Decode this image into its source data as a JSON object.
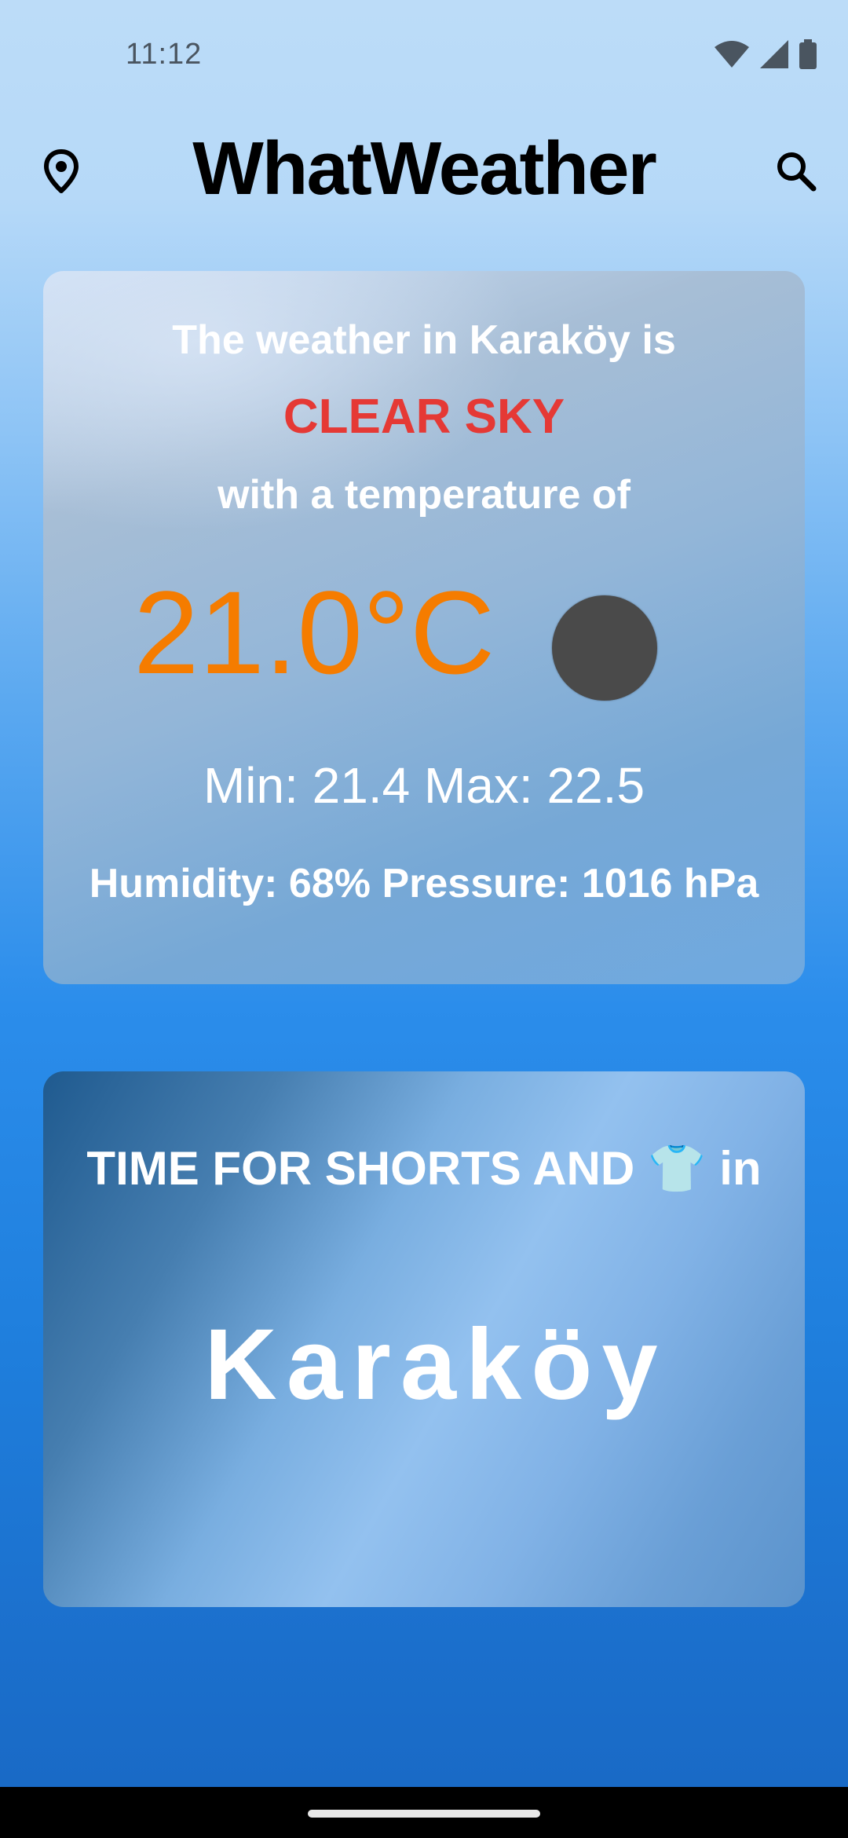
{
  "status_bar": {
    "time": "11:12"
  },
  "app_bar": {
    "title": "WhatWeather",
    "left_icon": "location-pin-icon",
    "right_icon": "search-icon"
  },
  "weather": {
    "intro": "The weather in Karaköy is",
    "condition": "CLEAR SKY",
    "temp_intro": "with a temperature of",
    "temperature": "21.0°C",
    "min_max": "Min: 21.4 Max: 22.5",
    "details": "Humidity: 68% Pressure: 1016 hPa"
  },
  "advice": {
    "message": "TIME FOR SHORTS AND 👕 in",
    "city": "Karaköy"
  },
  "colors": {
    "condition": "#e53935",
    "temperature": "#f57c00",
    "title": "#000000"
  }
}
